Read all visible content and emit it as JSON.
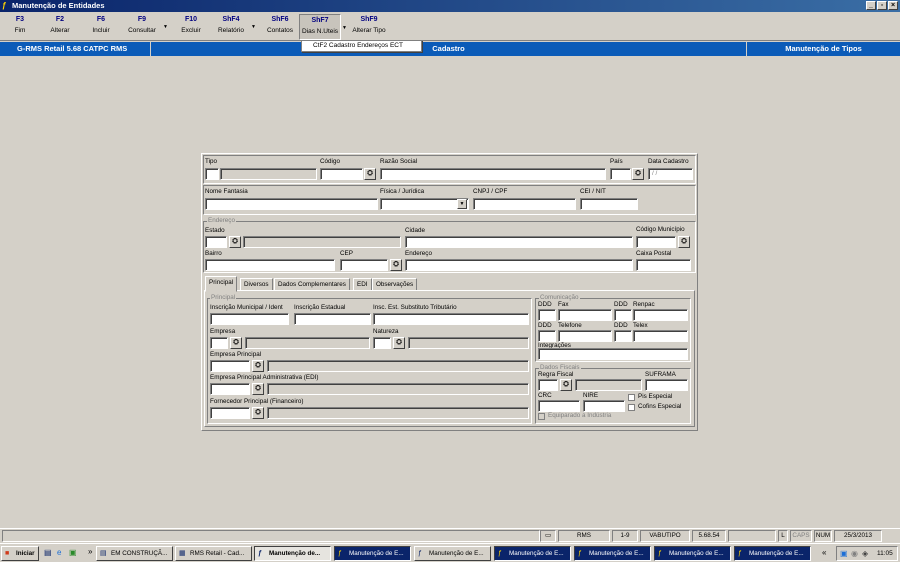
{
  "window": {
    "title": "Manutenção de Entidades",
    "minimize": "_",
    "restore": "▫",
    "close": "×"
  },
  "toolbar": [
    {
      "key": "F3",
      "label": "Fim"
    },
    {
      "key": "F2",
      "label": "Alterar"
    },
    {
      "key": "F6",
      "label": "Incluir"
    },
    {
      "key": "F9",
      "label": "Consultar"
    },
    {
      "key": "F10",
      "label": "Excluir"
    },
    {
      "key": "ShF4",
      "label": "Relatório"
    },
    {
      "key": "ShF6",
      "label": "Contatos"
    },
    {
      "key": "ShF7",
      "label": "Dias N.Uteis"
    },
    {
      "key": "ShF9",
      "label": "Alterar Tipo"
    }
  ],
  "dropdown_item": "CtF2  Cadastro Endereços ECT",
  "bluebar": {
    "app": "G-RMS Retail 5.68 CATPC RMS",
    "center": "Cadastro",
    "right": "Manutenção de Tipos"
  },
  "form": {
    "tipo": "Tipo",
    "codigo": "Código",
    "razao_social": "Razão Social",
    "pais": "País",
    "data_cadastro": "Data Cadastro",
    "data_value": " / /",
    "nome_fantasia": "Nome Fantasia",
    "fisica_juridica": "Física / Jurídica",
    "cnpj_cpf": "CNPJ / CPF",
    "cei_nit": "CEI / NIT",
    "endereco_group": "Endereço",
    "estado": "Estado",
    "cidade": "Cidade",
    "codigo_municipio": "Código Município",
    "bairro": "Bairro",
    "cep": "CEP",
    "endereco": "Endereço",
    "caixa_postal": "Caixa Postal"
  },
  "tabs": [
    "Principal",
    "Diversos",
    "Dados Complementares",
    "EDI",
    "Observações"
  ],
  "principal": {
    "group": "Principal",
    "inscricao_municipal": "Inscrição Municipal / Ident",
    "inscricao_estadual": "Inscrição Estadual",
    "insc_substituto": "Insc. Est. Substituto Tributário",
    "empresa": "Empresa",
    "natureza": "Natureza",
    "empresa_principal": "Empresa Principal",
    "empresa_principal_adm": "Empresa Principal Administrativa (EDI)",
    "fornecedor_principal": "Fornecedor Principal (Financeiro)"
  },
  "comunicacao": {
    "group": "Comunicação",
    "ddd": "DDD",
    "fax": "Fax",
    "renpac": "Renpac",
    "telefone": "Telefone",
    "telex": "Telex",
    "integracoes": "Integrações"
  },
  "fiscais": {
    "group": "Dados Fiscais",
    "regra_fiscal": "Regra Fiscal",
    "suframa": "SUFRAMA",
    "crc": "CRC",
    "nire": "NIRE",
    "pis_especial": "Pis Especial",
    "cofins_especial": "Cofins Especial",
    "equiparado": "Equiparado a Indústria"
  },
  "statusbar": {
    "system": "RMS",
    "pos": "1-9",
    "code": "VABUTIPO",
    "version": "5.68.54",
    "l": "L",
    "caps": "CAPS",
    "num": "NUM",
    "date": "25/3/2013"
  },
  "taskbar": {
    "start": "Iniciar",
    "chevron": "»",
    "tasks": [
      "EM CONSTRUÇÃ...",
      "RMS Retail - Cad...",
      "Manutenção de...",
      "Manutenção de E...",
      "Manutenção de E...",
      "Manutenção de E...",
      "Manutenção de E...",
      "Manutenção de E...",
      "Manutenção de E..."
    ],
    "clock": "11:05"
  }
}
